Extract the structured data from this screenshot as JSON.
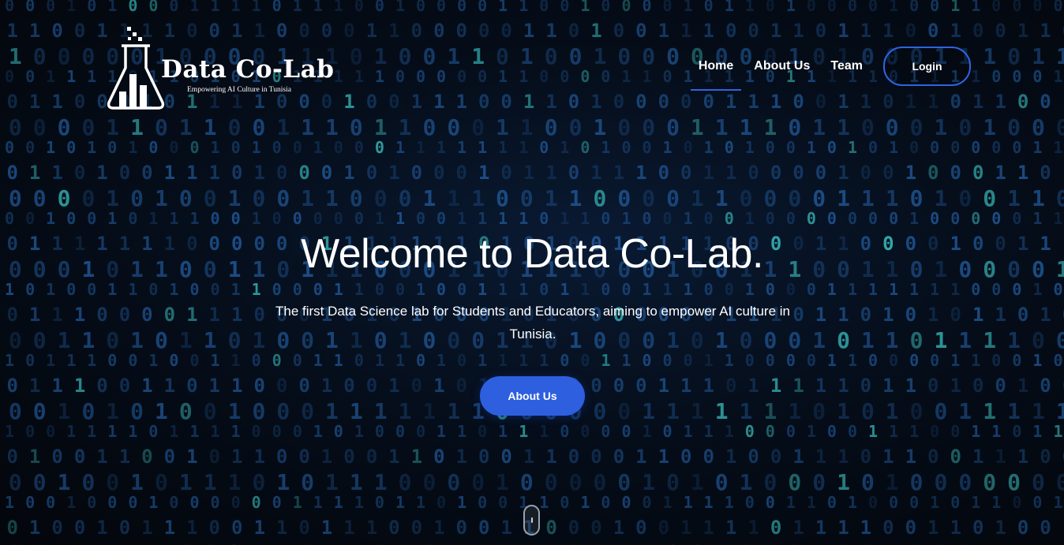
{
  "brand": {
    "name": "Data Co-Lab",
    "tagline": "Empowering AI Culture in Tunisia",
    "icon": "flask-bar-chart-icon"
  },
  "nav": {
    "items": [
      {
        "label": "Home",
        "active": true
      },
      {
        "label": "About Us",
        "active": false
      },
      {
        "label": "Team",
        "active": false
      }
    ],
    "login_label": "Login"
  },
  "hero": {
    "title": "Welcome to Data Co-Lab.",
    "subtitle": "The first Data Science lab for Students and Educators, aiming to empower AI culture in Tunisia.",
    "cta_label": "About Us",
    "scroll_icon": "mouse-scroll-icon"
  },
  "colors": {
    "accent": "#2d5fdf",
    "background": "#05070c",
    "text": "#ffffff"
  }
}
